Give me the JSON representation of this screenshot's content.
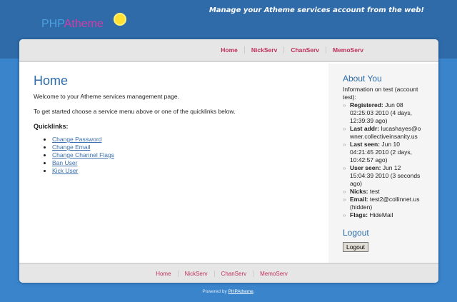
{
  "header": {
    "logo_php": "PHP",
    "logo_atheme": "Atheme",
    "tagline": "Manage your Atheme services account from the web!"
  },
  "nav": [
    "Home",
    "NickServ",
    "ChanServ",
    "MemoServ"
  ],
  "main": {
    "title": "Home",
    "welcome": "Welcome to your Atheme services management page.",
    "intro": "To get started choose a service menu above or one of the quicklinks below.",
    "quicklinks_label": "Quicklinks:",
    "quicklinks": [
      "Change Password",
      "Change Email",
      "Change Channel Flags",
      "Ban User",
      "Kick User"
    ]
  },
  "about": {
    "title": "About You",
    "info": "Information on test (account test):",
    "items": [
      {
        "label": "Registered:",
        "value": " Jun 08 02:25:03 2010 (4 days, 12:39:39 ago)"
      },
      {
        "label": "Last addr:",
        "value": " lucashayes@owner.collectiveinsanity.us"
      },
      {
        "label": "Last seen:",
        "value": " Jun 10 04:21:45 2010 (2 days, 10:42:57 ago)"
      },
      {
        "label": "User seen:",
        "value": " Jun 12 15:04:39 2010 (3 seconds ago)"
      },
      {
        "label": "Nicks:",
        "value": " test"
      },
      {
        "label": "Email:",
        "value": " test2@collinnet.us (hidden)"
      },
      {
        "label": "Flags:",
        "value": " HideMail"
      }
    ]
  },
  "logout": {
    "title": "Logout",
    "button": "Logout"
  },
  "footer": {
    "powered": "Powered by ",
    "link": "PHPAtheme",
    "dot": "."
  }
}
